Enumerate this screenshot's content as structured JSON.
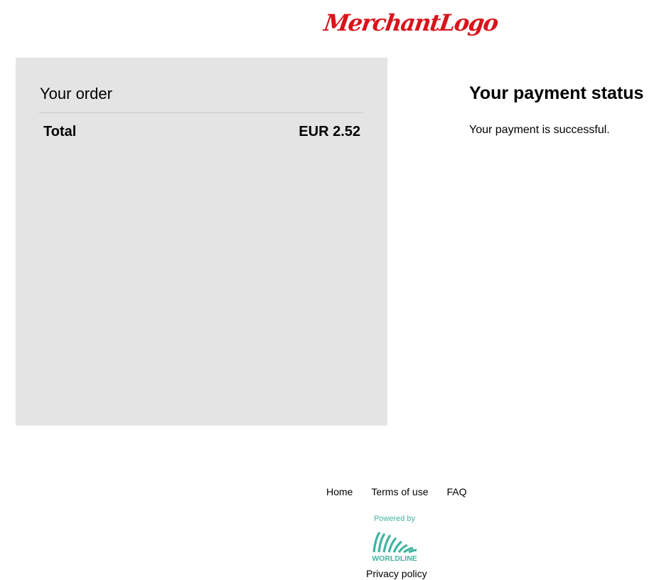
{
  "header": {
    "merchant_logo_text": "MerchantLogo"
  },
  "order": {
    "title": "Your order",
    "total_label": "Total",
    "total_value": "EUR 2.52"
  },
  "status": {
    "title": "Your payment status",
    "message": "Your payment is successful."
  },
  "footer": {
    "links": [
      "Home",
      "Terms of use",
      "FAQ"
    ],
    "powered_by": "Powered by",
    "brand_text": "WORLDLINE",
    "privacy_label": "Privacy policy"
  },
  "colors": {
    "merchant_logo": "#d9141b",
    "order_panel_bg": "#e4e4e4",
    "worldline_brand": "#41b4a2"
  },
  "icons": {
    "merchant_logo": "merchant-logo",
    "worldline_logo": "worldline-logo-icon"
  }
}
